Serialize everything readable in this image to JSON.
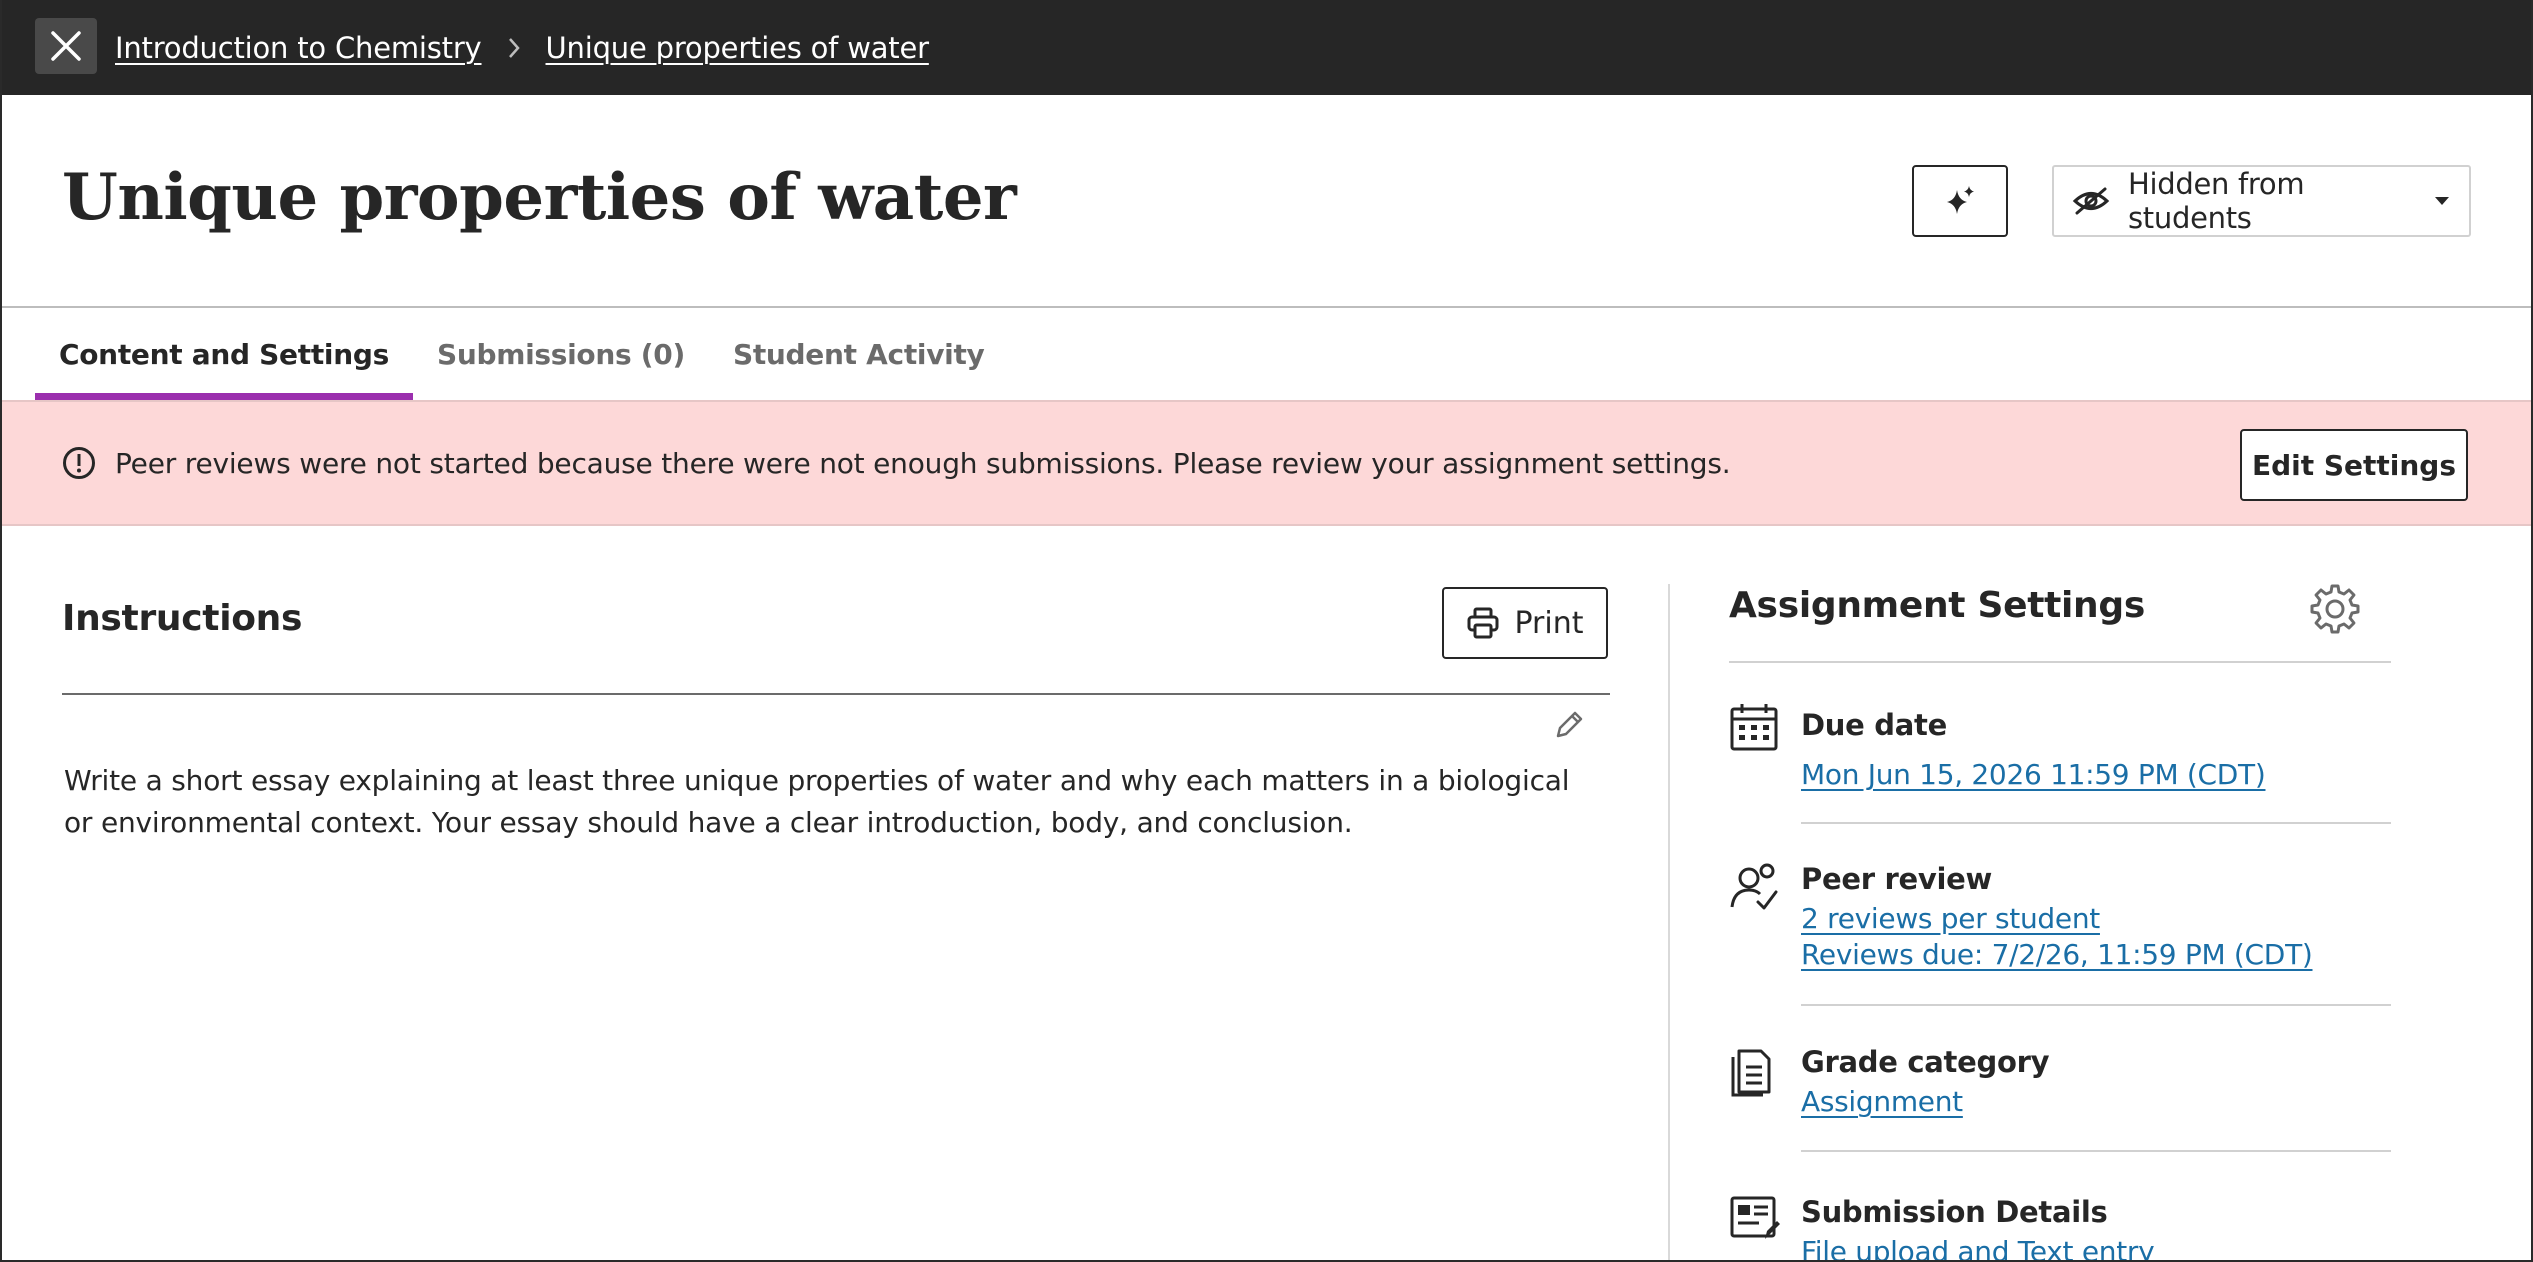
{
  "breadcrumb": {
    "items": [
      {
        "label": "Introduction to Chemistry"
      },
      {
        "label": "Unique properties of water"
      }
    ]
  },
  "header": {
    "title": "Unique properties of water",
    "visibility_label": "Hidden from students"
  },
  "tabs": [
    {
      "label": "Content and Settings",
      "active": true
    },
    {
      "label": "Submissions (0)",
      "active": false
    },
    {
      "label": "Student Activity",
      "active": false
    }
  ],
  "alert": {
    "message": "Peer reviews were not started because there were not enough submissions. Please review your assignment settings.",
    "button_label": "Edit Settings"
  },
  "instructions": {
    "title": "Instructions",
    "print_label": "Print",
    "body": "Write a short essay explaining at least three unique properties of water and why each matters in a biological or environmental context. Your essay should have a clear introduction, body, and conclusion."
  },
  "settings": {
    "title": "Assignment Settings",
    "due_date": {
      "name": "Due date",
      "value": "Mon Jun 15, 2026 11:59 PM (CDT)"
    },
    "peer_review": {
      "name": "Peer review",
      "reviews_per_student": "2 reviews per student",
      "reviews_due": "Reviews due: 7/2/26, 11:59 PM (CDT)"
    },
    "grade_category": {
      "name": "Grade category",
      "value": "Assignment"
    },
    "submission_details": {
      "name": "Submission Details",
      "value": "File upload and Text entry"
    }
  },
  "colors": {
    "topbar": "#262626",
    "accent_tab": "#9b2fae",
    "alert_bg": "#fdd8d8",
    "link": "#1a6ea6"
  }
}
